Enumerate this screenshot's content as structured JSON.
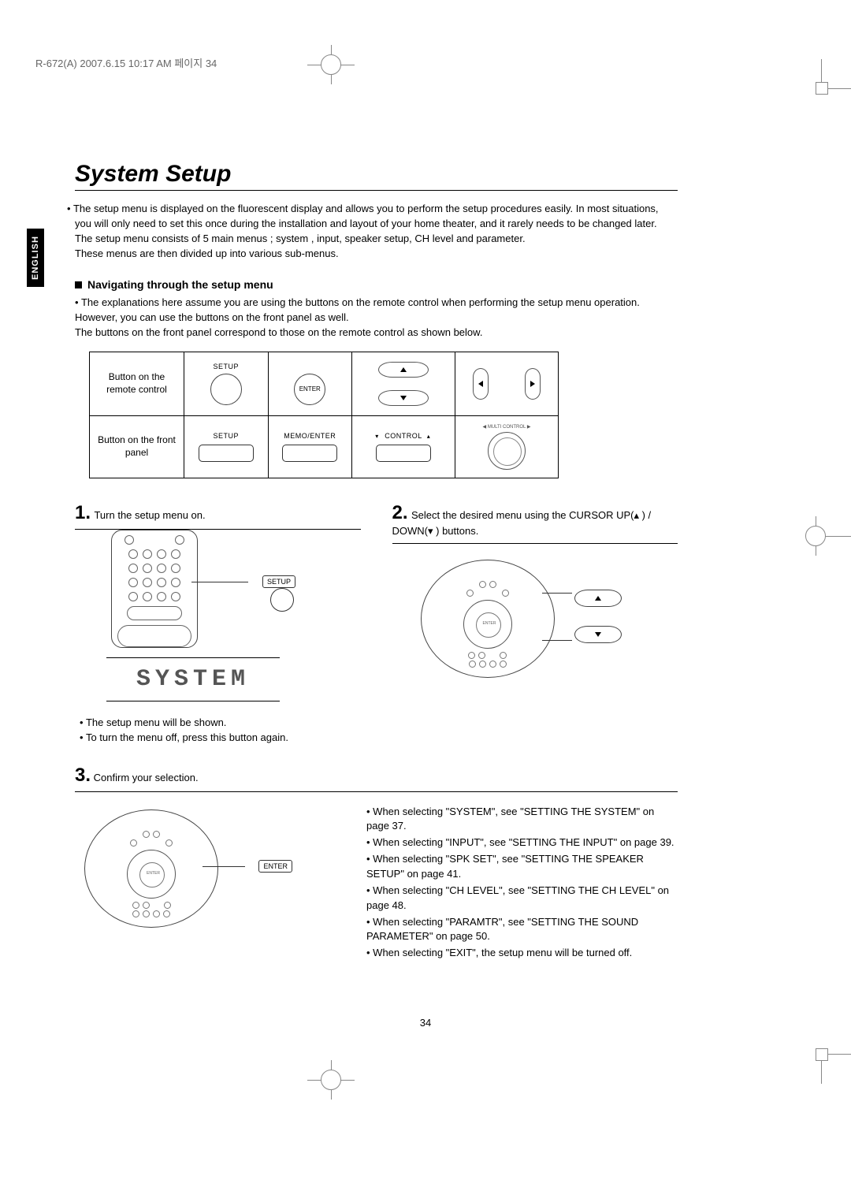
{
  "header": "R-672(A)  2007.6.15  10:17 AM  페이지 34",
  "lang_tab": "ENGLISH",
  "title": "System Setup",
  "intro_lines": [
    "The setup menu is displayed on the fluorescent display and allows you to perform the setup procedures easily. In most situations, you will only need to set this once during the installation and layout of your home theater, and it rarely needs to be changed later.",
    "The setup menu consists of 5 main menus ; system , input, speaker setup, CH level and parameter.",
    "These menus are then divided up into various sub-menus."
  ],
  "nav_head": "Navigating through the setup menu",
  "nav_lines": [
    "The explanations here assume you are using the buttons on the remote control when performing the setup menu operation. However, you can use the buttons on the front panel as well.",
    "The buttons on the front panel correspond to those on the remote control as shown below."
  ],
  "table": {
    "row1_label": "Button on the remote control",
    "row2_label": "Button on the front panel",
    "setup": "SETUP",
    "enter": "ENTER",
    "memo_enter": "MEMO/ENTER",
    "control": "CONTROL",
    "multi_control": "◀  MULTI CONTROL  ▶"
  },
  "steps": {
    "s1": {
      "num": "1.",
      "text": "Turn the setup menu on."
    },
    "s2": {
      "num": "2.",
      "text": "Select the desired menu using the CURSOR UP(▴ ) / DOWN(▾ ) buttons."
    },
    "s3": {
      "num": "3.",
      "text": "Confirm your selection."
    }
  },
  "callouts": {
    "setup": "SETUP",
    "enter": "ENTER"
  },
  "display_text": "SYSTEM",
  "s1_bullets": [
    "The setup menu will be shown.",
    "To turn the menu off, press this button again."
  ],
  "refs": [
    "When selecting \"SYSTEM\", see \"SETTING THE SYSTEM\" on page 37.",
    "When selecting \"INPUT\", see \"SETTING THE INPUT\" on page 39.",
    "When selecting \"SPK SET\", see \"SETTING THE SPEAKER SETUP\" on page 41.",
    "When selecting \"CH LEVEL\", see \"SETTING THE CH LEVEL\" on page 48.",
    "When selecting \"PARAMTR\", see \"SETTING THE SOUND PARAMETER\" on page 50.",
    "When selecting \"EXIT\", the setup menu will be turned off."
  ],
  "pagenum": "34"
}
